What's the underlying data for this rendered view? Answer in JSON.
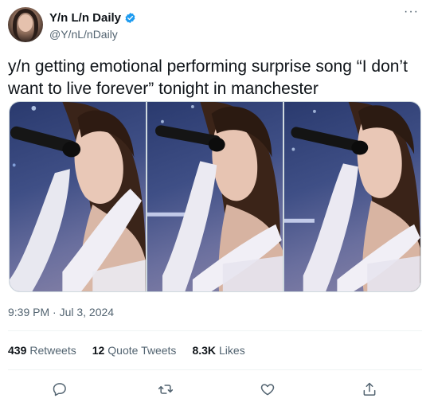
{
  "author": {
    "display_name": "Y/n L/n Daily",
    "handle": "@Y/nL/nDaily"
  },
  "more_glyph": "···",
  "tweet_text": "y/n getting emotional performing surprise song “I don’t want to live forever” tonight in manchester",
  "timestamp": "9:39 PM · Jul 3, 2024",
  "stats": {
    "retweets_count": "439",
    "retweets_label": "Retweets",
    "quotes_count": "12",
    "quotes_label": "Quote Tweets",
    "likes_count": "8.3K",
    "likes_label": "Likes"
  },
  "icons": {
    "verified": "verified-badge-icon",
    "reply": "reply-icon",
    "retweet": "retweet-icon",
    "like": "heart-icon",
    "share": "share-icon"
  },
  "colors": {
    "text": "#0f1419",
    "secondary": "#536471",
    "verified": "#1d9bf0",
    "divider": "#eff3f4"
  }
}
